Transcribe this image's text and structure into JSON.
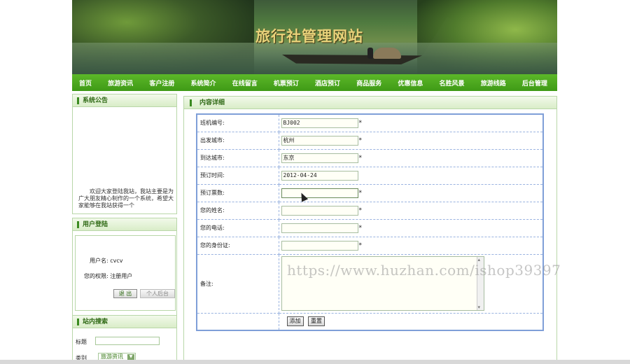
{
  "site": {
    "title": "旅行社管理网站"
  },
  "nav": [
    {
      "label": "首页"
    },
    {
      "label": "旅游资讯"
    },
    {
      "label": "客户注册"
    },
    {
      "label": "系统简介"
    },
    {
      "label": "在线留言"
    },
    {
      "label": "机票预订"
    },
    {
      "label": "酒店预订"
    },
    {
      "label": "商品服务"
    },
    {
      "label": "优惠信息"
    },
    {
      "label": "名胜风景"
    },
    {
      "label": "旅游线路"
    },
    {
      "label": "后台管理"
    }
  ],
  "sidebar": {
    "notice": {
      "title": "系统公告",
      "text": "欢迎大家登陆我站，我站主要是为广大朋友精心制作的一个系统，希望大家能够在我站获得一个"
    },
    "login": {
      "title": "用户登陆",
      "username_line": "用户名: cvcv",
      "permission_line": "您的权限: 注册用户",
      "logout_label": "退 出",
      "personal_label": "个人后台"
    },
    "search": {
      "title": "站内搜索",
      "title_label": "标题",
      "category_label": "类别",
      "category_value": "旅游资讯",
      "title_value": ""
    }
  },
  "content": {
    "title": "内容详细",
    "fields": [
      {
        "label": "班机编号:",
        "value": "BJ002",
        "required": "*"
      },
      {
        "label": "出发城市:",
        "value": "杭州",
        "required": "*"
      },
      {
        "label": "到达城市:",
        "value": "东京",
        "required": "*"
      },
      {
        "label": "预订时间:",
        "value": "2012-04-24",
        "required": ""
      },
      {
        "label": "预订票数:",
        "value": "",
        "required": "*"
      },
      {
        "label": "您的姓名:",
        "value": "",
        "required": "*"
      },
      {
        "label": "您的电话:",
        "value": "",
        "required": "*"
      },
      {
        "label": "您的身份证:",
        "value": "",
        "required": "*"
      }
    ],
    "remark_label": "备注:",
    "remark_value": "",
    "add_label": "添加",
    "reset_label": "重置"
  },
  "watermark": "https://www.huzhan.com/ishop39397"
}
